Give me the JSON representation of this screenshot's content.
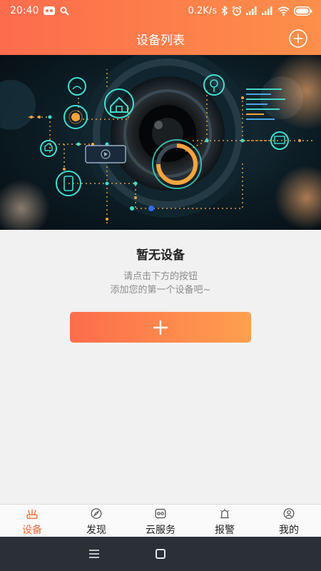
{
  "status_bar": {
    "time": "20:40",
    "speed": "0.2K/s",
    "icons": [
      "app-notification-icon",
      "search-icon",
      "bluetooth-icon",
      "alarm-icon",
      "signal-icon",
      "signal-icon",
      "wifi-icon",
      "battery-icon"
    ]
  },
  "header": {
    "title": "设备列表",
    "add_icon": "add-circle-icon"
  },
  "empty_state": {
    "title": "暂无设备",
    "hint_line1": "请点击下方的按钮",
    "hint_line2": "添加您的第一个设备吧~",
    "add_icon": "plus-icon"
  },
  "tabs": [
    {
      "label": "设备",
      "icon": "router-icon",
      "active": true
    },
    {
      "label": "发现",
      "icon": "compass-icon",
      "active": false
    },
    {
      "label": "云服务",
      "icon": "cloud-service-icon",
      "active": false
    },
    {
      "label": "报警",
      "icon": "alarm-light-icon",
      "active": false
    },
    {
      "label": "我的",
      "icon": "profile-icon",
      "active": false
    }
  ],
  "colors": {
    "accent": "#f56b3e",
    "header_start": "#fd6c4c",
    "header_end": "#fd8f4a",
    "background": "#f1f1f1",
    "nav_bar": "#2b2f36"
  }
}
